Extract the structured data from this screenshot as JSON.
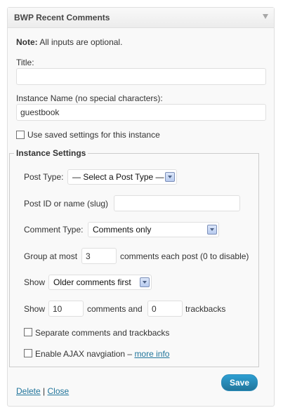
{
  "widget": {
    "title": "BWP Recent Comments",
    "note_bold": "Note:",
    "note_text": " All inputs are optional.",
    "title_label": "Title:",
    "title_value": "",
    "instance_label": "Instance Name (no special characters):",
    "instance_value": "guestbook",
    "use_saved_label": "Use saved settings for this instance",
    "use_saved_checked": false
  },
  "instance_settings": {
    "legend": "Instance Settings",
    "post_type_label": "Post Type:",
    "post_type_selected": "— Select a Post Type —",
    "post_id_label": "Post ID or name (slug)",
    "post_id_value": "",
    "comment_type_label": "Comment Type:",
    "comment_type_selected": "Comments only",
    "group_label_pre": "Group at most",
    "group_value": "3",
    "group_label_post": "comments each post (0 to disable)",
    "show_order_label": "Show",
    "show_order_selected": "Older comments first",
    "show_count_label": "Show",
    "comments_value": "10",
    "comments_and_label": "comments and",
    "trackbacks_value": "0",
    "trackbacks_label": "trackbacks",
    "separate_label": "Separate comments and trackbacks",
    "separate_checked": false,
    "ajax_label": "Enable AJAX navgiation – ",
    "ajax_link": "more info",
    "ajax_checked": false
  },
  "footer": {
    "delete_label": "Delete",
    "separator": "|",
    "close_label": "Close",
    "save_label": "Save"
  },
  "colors": {
    "link": "#21759b",
    "save_button": "#21759b",
    "widget_bg": "#f9f9f9"
  }
}
